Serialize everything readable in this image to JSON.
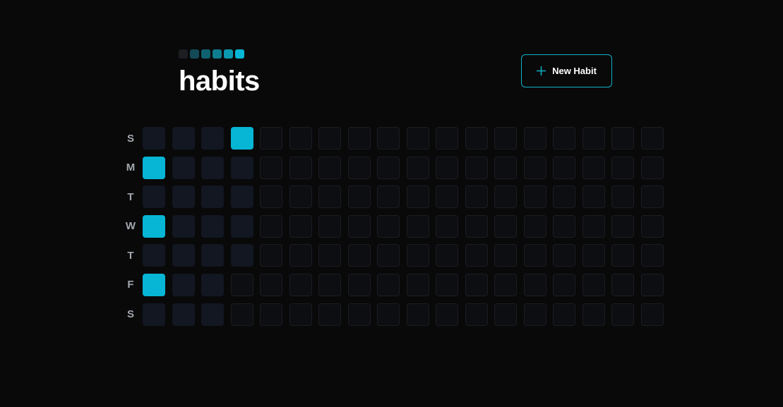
{
  "app": {
    "title": "habits",
    "logo_colors": [
      "#1c1e22",
      "#134a57",
      "#106170",
      "#0e7d8f",
      "#0a99ae",
      "#06b6d4"
    ]
  },
  "toolbar": {
    "new_habit_label": "New Habit",
    "new_habit_icon": "plus-icon",
    "accent": "#06b6d4"
  },
  "grid": {
    "day_labels": [
      "S",
      "M",
      "T",
      "W",
      "T",
      "F",
      "S"
    ],
    "weeks": 18,
    "cell_states_legend": {
      "done": "#06b6d4",
      "past": "#121722",
      "future": "#0d0e11"
    },
    "rows": [
      [
        "past",
        "past",
        "past",
        "done",
        "future",
        "future",
        "future",
        "future",
        "future",
        "future",
        "future",
        "future",
        "future",
        "future",
        "future",
        "future",
        "future",
        "future"
      ],
      [
        "done",
        "past",
        "past",
        "past",
        "future",
        "future",
        "future",
        "future",
        "future",
        "future",
        "future",
        "future",
        "future",
        "future",
        "future",
        "future",
        "future",
        "future"
      ],
      [
        "past",
        "past",
        "past",
        "past",
        "future",
        "future",
        "future",
        "future",
        "future",
        "future",
        "future",
        "future",
        "future",
        "future",
        "future",
        "future",
        "future",
        "future"
      ],
      [
        "done",
        "past",
        "past",
        "past",
        "future",
        "future",
        "future",
        "future",
        "future",
        "future",
        "future",
        "future",
        "future",
        "future",
        "future",
        "future",
        "future",
        "future"
      ],
      [
        "past",
        "past",
        "past",
        "past",
        "future",
        "future",
        "future",
        "future",
        "future",
        "future",
        "future",
        "future",
        "future",
        "future",
        "future",
        "future",
        "future",
        "future"
      ],
      [
        "done",
        "past",
        "past",
        "future",
        "future",
        "future",
        "future",
        "future",
        "future",
        "future",
        "future",
        "future",
        "future",
        "future",
        "future",
        "future",
        "future",
        "future"
      ],
      [
        "past",
        "past",
        "past",
        "future",
        "future",
        "future",
        "future",
        "future",
        "future",
        "future",
        "future",
        "future",
        "future",
        "future",
        "future",
        "future",
        "future",
        "future"
      ]
    ]
  }
}
